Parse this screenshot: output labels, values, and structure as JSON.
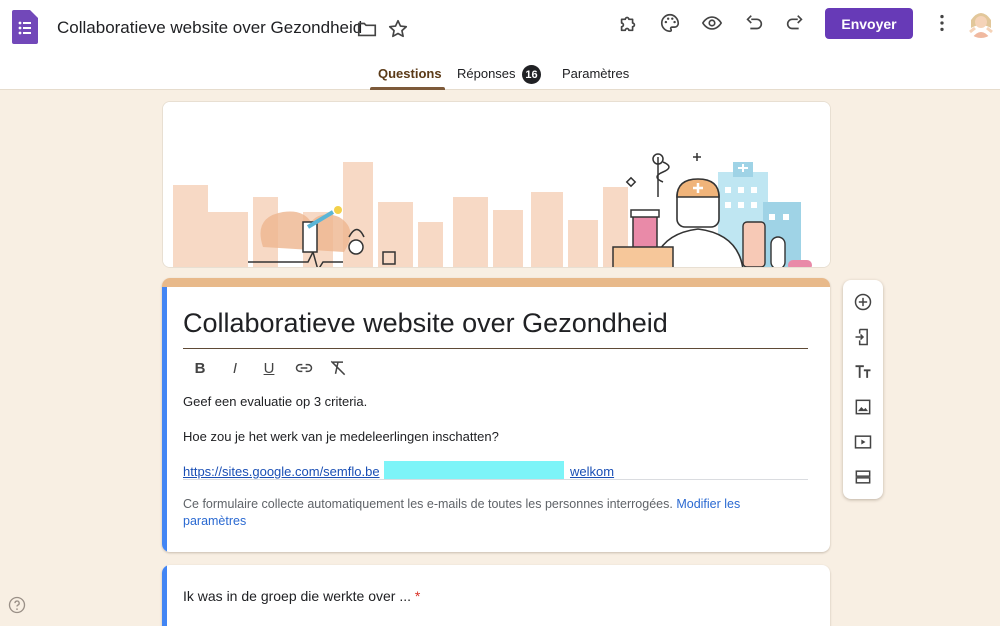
{
  "header": {
    "title": "Collaboratieve website over Gezondheid",
    "send_label": "Envoyer",
    "icons": [
      "forms-logo-icon",
      "folder-icon",
      "star-icon",
      "addon-icon",
      "palette-icon",
      "preview-eye-icon",
      "undo-icon",
      "redo-icon",
      "more-vert-icon"
    ]
  },
  "tabs": {
    "questions": "Questions",
    "responses": "Réponses",
    "responses_count": "16",
    "settings": "Paramètres"
  },
  "form": {
    "title": "Collaboratieve website over Gezondheid",
    "format_tools": [
      "B",
      "I",
      "U"
    ],
    "line1": "Geef een evaluatie op 3 criteria.",
    "line2": "Hoe zou je het werk van je medeleerlingen inschatten?",
    "link1": "https://sites.google.com/semflo.be",
    "link2": "welkom",
    "note": "Ce formulaire collecte automatiquement les e-mails de toutes les personnes interrogées.",
    "note_link": "Modifier les paramètres"
  },
  "side_toolbar": [
    "add-question-icon",
    "import-questions-icon",
    "add-title-icon",
    "add-image-icon",
    "add-video-icon",
    "add-section-icon"
  ],
  "question1": {
    "text": "Ik was in de groep die werkte over ...",
    "required_mark": "*"
  },
  "colors": {
    "accent": "#673ab7",
    "background": "#f8efe3",
    "card_top": "#e8b98a",
    "left_bar": "#4285f4"
  }
}
